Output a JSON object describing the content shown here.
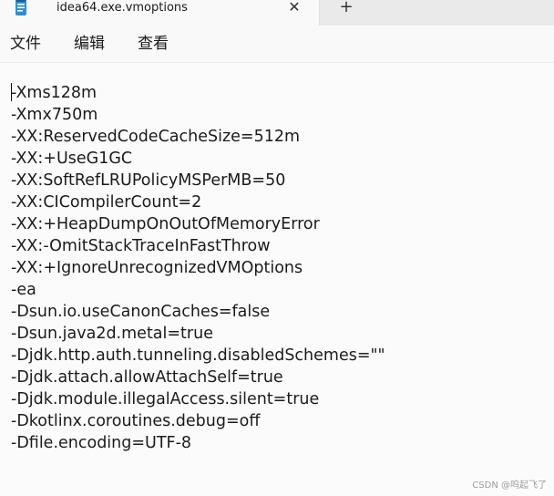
{
  "tab": {
    "icon": "notepad-icon",
    "title": "idea64.exe.vmoptions",
    "close_glyph": "✕",
    "new_tab_glyph": "+"
  },
  "menu": {
    "file": "文件",
    "edit": "编辑",
    "view": "查看"
  },
  "editor": {
    "lines": [
      "-Xms128m",
      "-Xmx750m",
      "-XX:ReservedCodeCacheSize=512m",
      "-XX:+UseG1GC",
      "-XX:SoftRefLRUPolicyMSPerMB=50",
      "-XX:CICompilerCount=2",
      "-XX:+HeapDumpOnOutOfMemoryError",
      "-XX:-OmitStackTraceInFastThrow",
      "-XX:+IgnoreUnrecognizedVMOptions",
      "-ea",
      "-Dsun.io.useCanonCaches=false",
      "-Dsun.java2d.metal=true",
      "-Djdk.http.auth.tunneling.disabledSchemes=\"\"",
      "-Djdk.attach.allowAttachSelf=true",
      "-Djdk.module.illegalAccess.silent=true",
      "-Dkotlinx.coroutines.debug=off",
      "-Dfile.encoding=UTF-8"
    ]
  },
  "watermark": "CSDN @呜起飞了"
}
